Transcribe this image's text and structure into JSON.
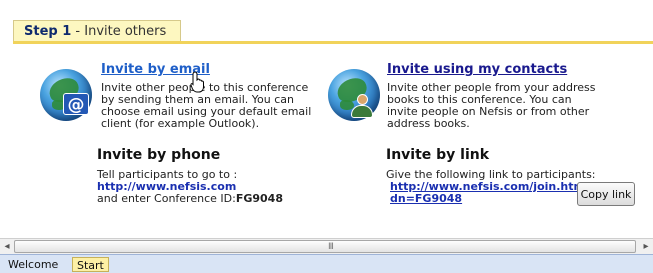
{
  "step": {
    "label": "Step 1",
    "subtitle": "- Invite others"
  },
  "email": {
    "title": "Invite by email",
    "description": [
      "Invite other people to this conference",
      "by sending them an email. You can",
      "choose email using your default email",
      "client (for example Outlook)."
    ]
  },
  "contacts": {
    "title": "Invite using my contacts",
    "description": [
      "Invite other people from your address",
      "books to this conference. You can",
      "invite people on Nefsis or from other",
      "address books."
    ]
  },
  "phone": {
    "heading": "Invite by phone",
    "instruction": "Tell participants to go to :",
    "url": "http://www.nefsis.com",
    "conference_prefix": "and enter Conference ID:",
    "conference_id": "FG9048"
  },
  "link": {
    "heading": "Invite by link",
    "instruction": "Give the following link to participants:",
    "url_line1": "http://www.nefsis.com/join.html?",
    "url_line2": "dn=FG9048",
    "copy_button": "Copy link"
  },
  "scrollbar": {
    "left_arrow": "◂",
    "right_arrow": "▸",
    "grip": "III"
  },
  "tabs": [
    {
      "label": "Welcome"
    },
    {
      "label": "Start"
    }
  ],
  "colors": {
    "accent_yellow": "#f1d35a",
    "link_blue": "#1f5fc8",
    "link_navy": "#1a1a8e"
  }
}
